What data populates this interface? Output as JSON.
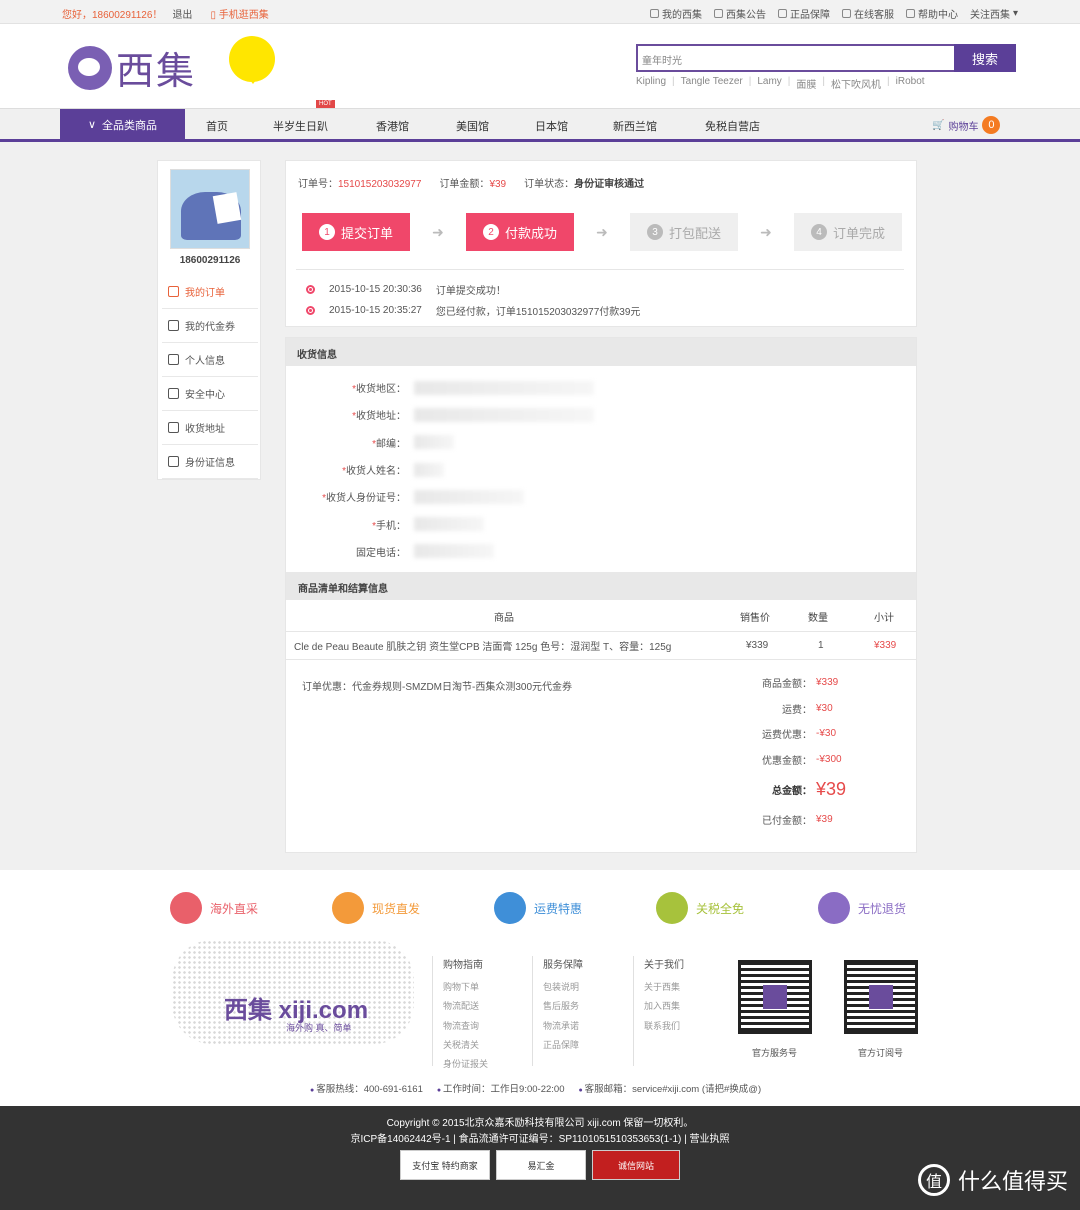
{
  "topbar": {
    "greeting": "您好，18600291126！",
    "logout": "退出",
    "mobile": "手机逛西集",
    "links": [
      "我的西集",
      "西集公告",
      "正品保障",
      "在线客服",
      "帮助中心",
      "关注西集"
    ]
  },
  "header": {
    "logo_text": "西集",
    "search_placeholder": "童年时光",
    "search_button": "搜索",
    "hotwords": [
      "Kipling",
      "Tangle Teezer",
      "Lamy",
      "面膜",
      "松下吹风机",
      "iRobot"
    ]
  },
  "nav": {
    "all": "全品类商品",
    "items": [
      "首页",
      "半岁生日趴",
      "香港馆",
      "美国馆",
      "日本馆",
      "新西兰馆",
      "免税自营店"
    ],
    "hot_badge": "HOT",
    "cart_label": "购物车",
    "cart_count": "0"
  },
  "sidebar": {
    "username": "18600291126",
    "menu": [
      "我的订单",
      "我的代金券",
      "个人信息",
      "安全中心",
      "收货地址",
      "身份证信息"
    ]
  },
  "order": {
    "no_label": "订单号：",
    "no": "151015203032977",
    "amount_label": "订单金额：",
    "amount": "¥39",
    "status_label": "订单状态：",
    "status": "身份证审核通过",
    "steps": [
      {
        "num": "1",
        "label": "提交订单",
        "active": true
      },
      {
        "num": "2",
        "label": "付款成功",
        "active": true
      },
      {
        "num": "3",
        "label": "打包配送",
        "active": false
      },
      {
        "num": "4",
        "label": "订单完成",
        "active": false
      }
    ],
    "logs": [
      {
        "time": "2015-10-15 20:30:36",
        "text": "订单提交成功！"
      },
      {
        "time": "2015-10-15 20:35:27",
        "text": "您已经付款，订单151015203032977付款39元"
      }
    ]
  },
  "shipping": {
    "title": "收货信息",
    "fields": [
      {
        "label": "收货地区：",
        "required": true
      },
      {
        "label": "收货地址：",
        "required": true
      },
      {
        "label": "邮编：",
        "required": true
      },
      {
        "label": "收货人姓名：",
        "required": true
      },
      {
        "label": "收货人身份证号：",
        "required": true
      },
      {
        "label": "手机：",
        "required": true
      },
      {
        "label": "固定电话：",
        "required": false
      }
    ]
  },
  "goods": {
    "title": "商品清单和结算信息",
    "headers": [
      "商品",
      "销售价",
      "数量",
      "小计"
    ],
    "rows": [
      {
        "name": "Cle de Peau Beaute 肌肤之钥 资生堂CPB 洁面膏 125g 色号：湿润型 T、容量：125g",
        "price": "¥339",
        "qty": "1",
        "subtotal": "¥339"
      }
    ],
    "coupon": "订单优惠：代金券规则-SMZDM日淘节-西集众测300元代金券",
    "sums": [
      {
        "k": "商品金额：",
        "v": "¥339"
      },
      {
        "k": "运费：",
        "v": "¥30"
      },
      {
        "k": "运费优惠：",
        "v": "-¥30"
      },
      {
        "k": "优惠金额：",
        "v": "-¥300"
      },
      {
        "k": "总金额：",
        "v": "¥39"
      },
      {
        "k": "已付金额：",
        "v": "¥39"
      }
    ]
  },
  "footer": {
    "features": [
      "海外直采",
      "现货直发",
      "运费特惠",
      "关税全免",
      "无忧退货"
    ],
    "feature_colors": [
      "#e9606a",
      "#f39a3a",
      "#3f8fd8",
      "#a7c23c",
      "#8a6cc4"
    ],
    "map_logo": "西集 xiji.com",
    "map_slogan": "海外购 真、简单",
    "columns": [
      {
        "title": "购物指南",
        "links": [
          "购物下单",
          "物流配送",
          "物流查询",
          "关税清关",
          "身份证报关"
        ]
      },
      {
        "title": "服务保障",
        "links": [
          "包装说明",
          "售后服务",
          "物流承诺",
          "正品保障"
        ]
      },
      {
        "title": "关于我们",
        "links": [
          "关于西集",
          "加入西集",
          "联系我们"
        ]
      }
    ],
    "qr_labels": [
      "官方服务号",
      "官方订阅号"
    ],
    "contacts": [
      "客服热线：400-691-6161",
      "工作时间：工作日9:00-22:00",
      "客服邮箱：service#xiji.com (请把#换成@)"
    ],
    "copyright1": "Copyright © 2015北京众嘉禾励科技有限公司 xiji.com 保留一切权利。",
    "copyright2": "京ICP备14062442号-1 | 食品流通许可证编号：SP1101051510353653(1-1) | 营业执照",
    "badges": [
      "支付宝 特约商家",
      "易汇金",
      "诚信网站"
    ],
    "watermark": "什么值得买"
  }
}
